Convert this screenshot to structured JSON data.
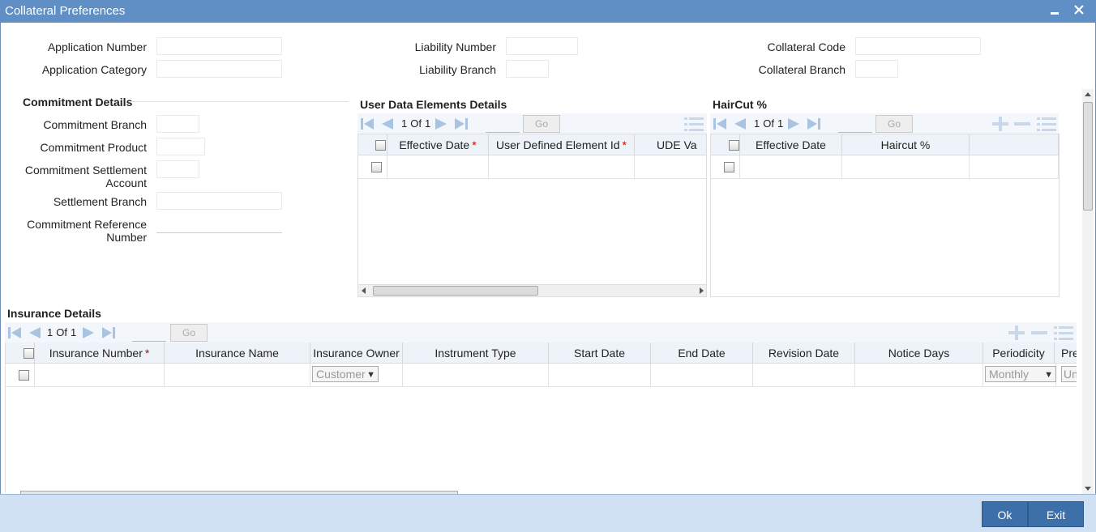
{
  "window": {
    "title": "Collateral Preferences",
    "minimize_icon": "minimize-icon",
    "close_icon": "close-icon"
  },
  "header_fields": {
    "application_number": {
      "label": "Application Number",
      "value": ""
    },
    "application_category": {
      "label": "Application Category",
      "value": ""
    },
    "liability_number": {
      "label": "Liability Number",
      "value": ""
    },
    "liability_branch": {
      "label": "Liability Branch",
      "value": ""
    },
    "collateral_code": {
      "label": "Collateral Code",
      "value": ""
    },
    "collateral_branch": {
      "label": "Collateral Branch",
      "value": ""
    }
  },
  "commitment": {
    "title": "Commitment Details",
    "branch_label": "Commitment Branch",
    "product_label": "Commitment Product",
    "settlement_account_label_1": "Commitment Settlement",
    "settlement_account_label_2": "Account",
    "settlement_branch_label": "Settlement Branch",
    "reference_label_1": "Commitment Reference",
    "reference_label_2": "Number"
  },
  "ude": {
    "title": "User Data Elements Details",
    "page_current": "1",
    "page_of": "Of",
    "page_total": "1",
    "go": "Go",
    "columns": [
      "Effective Date",
      "User Defined Element Id",
      "UDE Va"
    ]
  },
  "haircut": {
    "title": "HairCut %",
    "page_current": "1",
    "page_of": "Of",
    "page_total": "1",
    "go": "Go",
    "columns": [
      "Effective Date",
      "Haircut %"
    ]
  },
  "insurance": {
    "title": "Insurance Details",
    "page_current": "1",
    "page_of": "Of",
    "page_total": "1",
    "go": "Go",
    "columns": [
      "Insurance Number",
      "Insurance Name",
      "Insurance Owner",
      "Instrument Type",
      "Start Date",
      "End Date",
      "Revision Date",
      "Notice Days",
      "Periodicity",
      "Pre"
    ],
    "owner_value": "Customer",
    "periodicity_value": "Monthly",
    "last_value": "Unp"
  },
  "footer": {
    "ok": "Ok",
    "exit": "Exit"
  },
  "colors": {
    "titlebar": "#5f8fc4",
    "footer": "#cfe1f3",
    "button": "#3d6fa8",
    "required": "#cc0000"
  }
}
